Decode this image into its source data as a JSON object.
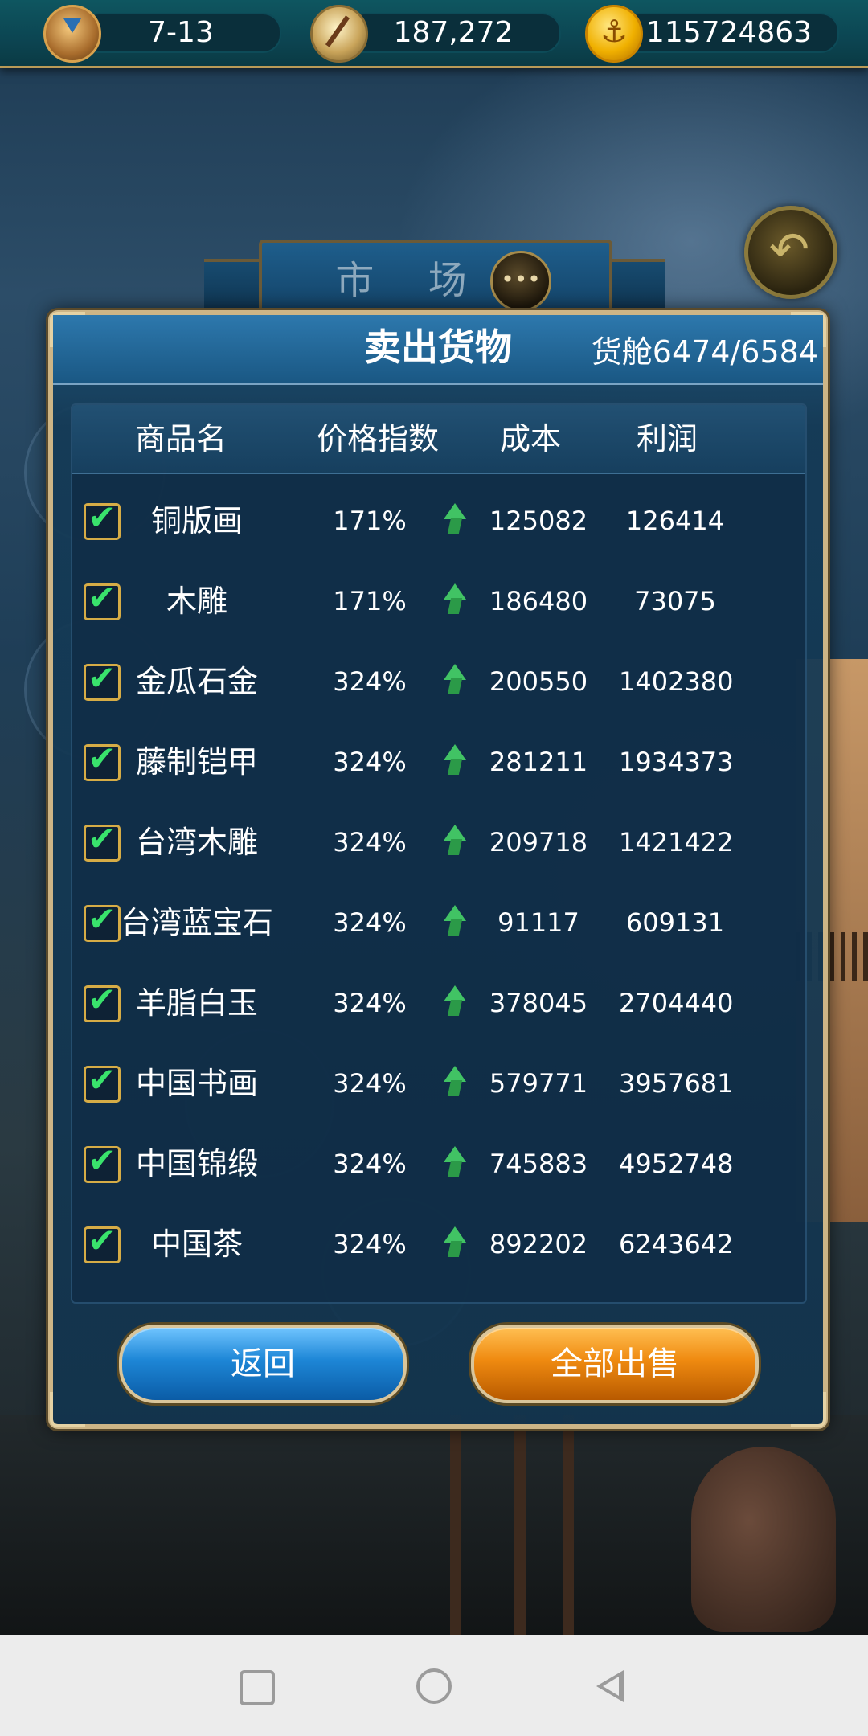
{
  "hud": {
    "date": "7-13",
    "reputation": "187,272",
    "gold": "115724863"
  },
  "market": {
    "title": "市 场"
  },
  "dialog": {
    "title": "卖出货物",
    "cargo": "货舱6474/6584",
    "headers": {
      "name": "商品名",
      "index": "价格指数",
      "cost": "成本",
      "profit": "利润"
    },
    "rows": [
      {
        "name": "铜版画",
        "index": "171%",
        "cost": "125082",
        "profit": "126414",
        "checked": true
      },
      {
        "name": "木雕",
        "index": "171%",
        "cost": "186480",
        "profit": "73075",
        "checked": true
      },
      {
        "name": "金瓜石金",
        "index": "324%",
        "cost": "200550",
        "profit": "1402380",
        "checked": true
      },
      {
        "name": "藤制铠甲",
        "index": "324%",
        "cost": "281211",
        "profit": "1934373",
        "checked": true
      },
      {
        "name": "台湾木雕",
        "index": "324%",
        "cost": "209718",
        "profit": "1421422",
        "checked": true
      },
      {
        "name": "台湾蓝宝石",
        "index": "324%",
        "cost": "91117",
        "profit": "609131",
        "checked": true
      },
      {
        "name": "羊脂白玉",
        "index": "324%",
        "cost": "378045",
        "profit": "2704440",
        "checked": true
      },
      {
        "name": "中国书画",
        "index": "324%",
        "cost": "579771",
        "profit": "3957681",
        "checked": true
      },
      {
        "name": "中国锦缎",
        "index": "324%",
        "cost": "745883",
        "profit": "4952748",
        "checked": true
      },
      {
        "name": "中国茶",
        "index": "324%",
        "cost": "892202",
        "profit": "6243642",
        "checked": true
      }
    ],
    "buttons": {
      "back": "返回",
      "sell_all": "全部出售"
    }
  },
  "icons": {
    "date": "hourglass-icon",
    "reputation": "compass-icon",
    "gold": "gold-coin-icon",
    "price_trend": "green-up-arrow-icon",
    "checkbox": "checkmark-icon"
  },
  "colors": {
    "hud_bg": "#0e5660",
    "dialog_border": "#cdb586",
    "check_green": "#39e36c",
    "arrow_green": "#41c364",
    "back_button": "#1d86d6",
    "sell_button": "#ef8a10"
  }
}
